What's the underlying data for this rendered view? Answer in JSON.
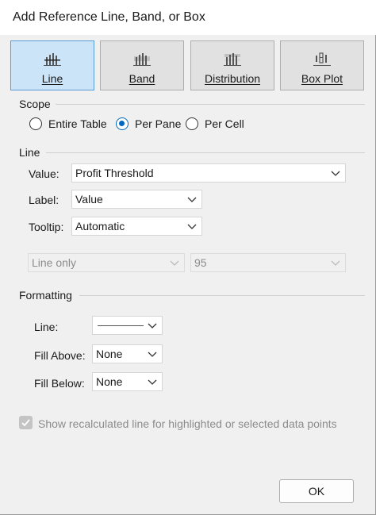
{
  "window": {
    "title": "Add Reference Line, Band, or Box"
  },
  "types": [
    {
      "label": "Line",
      "selected": true
    },
    {
      "label": "Band",
      "selected": false
    },
    {
      "label": "Distribution",
      "selected": false
    },
    {
      "label": "Box Plot",
      "selected": false
    }
  ],
  "scope": {
    "heading": "Scope",
    "options": [
      {
        "label": "Entire Table",
        "selected": false
      },
      {
        "label": "Per Pane",
        "selected": true
      },
      {
        "label": "Per Cell",
        "selected": false
      }
    ]
  },
  "line": {
    "heading": "Line",
    "value_label": "Value:",
    "value": "Profit Threshold",
    "label_label": "Label:",
    "label_value": "Value",
    "tooltip_label": "Tooltip:",
    "tooltip_value": "Automatic",
    "line_only": "Line only",
    "percent": "95"
  },
  "formatting": {
    "heading": "Formatting",
    "line_label": "Line:",
    "fill_above_label": "Fill Above:",
    "fill_above_value": "None",
    "fill_below_label": "Fill Below:",
    "fill_below_value": "None"
  },
  "recalc": {
    "label": "Show recalculated line for highlighted or selected data points",
    "checked": true,
    "disabled": true
  },
  "footer": {
    "ok_label": "OK"
  },
  "colors": {
    "accent": "#0067c0",
    "selected_button": "#cce4f7"
  }
}
